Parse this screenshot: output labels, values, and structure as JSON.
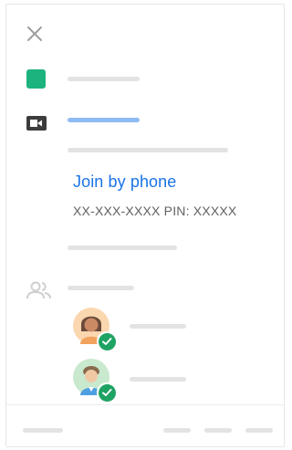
{
  "event": {
    "color": "#1db37e"
  },
  "conference": {
    "join_phone_label": "Join by phone",
    "phone_pin": "XX-XXX-XXXX PIN: XXXXX",
    "link_color": "#1a73e8"
  },
  "guests": [
    {
      "icon": "guest-avatar-female",
      "status": "accepted",
      "status_color": "#1ea363"
    },
    {
      "icon": "guest-avatar-male",
      "status": "accepted",
      "status_color": "#1ea363"
    }
  ],
  "icons": {
    "close": "close-icon",
    "video": "video-camera-icon",
    "people": "people-icon",
    "check": "check-icon"
  }
}
